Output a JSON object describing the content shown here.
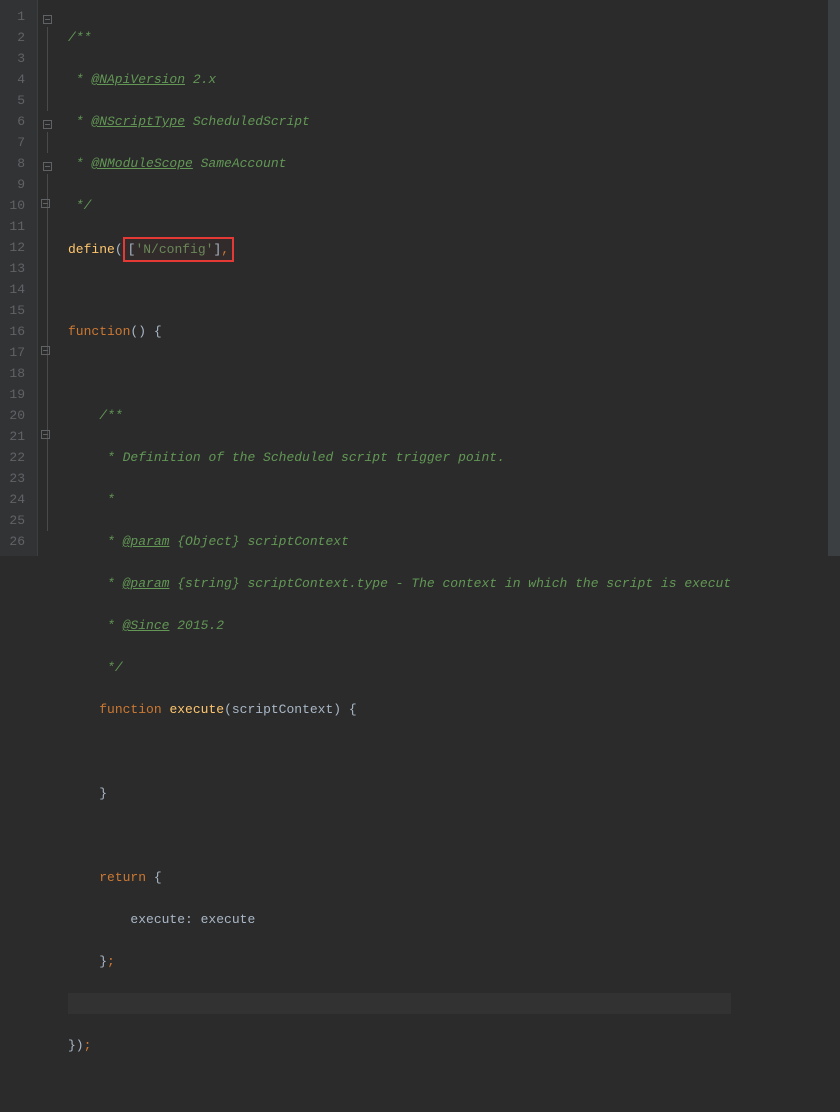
{
  "editor": {
    "line_count": 26,
    "highlight_text": "['N/config'],",
    "lines": {
      "l1": {
        "doc_open": "/**"
      },
      "l2": {
        "star": " * ",
        "tag": "@NApiVersion",
        "rest": " 2.x"
      },
      "l3": {
        "star": " * ",
        "tag": "@NScriptType",
        "rest": " ScheduledScript"
      },
      "l4": {
        "star": " * ",
        "tag": "@NModuleScope",
        "rest": " SameAccount"
      },
      "l5": {
        "doc_close": " */"
      },
      "l6": {
        "define": "define",
        "paren_open": "(",
        "paren_close": ""
      },
      "l8": {
        "kw": "function",
        "args": "() {"
      },
      "l10": {
        "doc_open": "/**"
      },
      "l11": {
        "star": " * ",
        "text": "Definition of the Scheduled script trigger point."
      },
      "l12": {
        "star": " *"
      },
      "l13": {
        "star": " * ",
        "tag": "@param",
        "rest": " {Object} scriptContext"
      },
      "l14": {
        "star": " * ",
        "tag": "@param",
        "rest": " {string} scriptContext.type - The context in which the script is execut"
      },
      "l15": {
        "star": " * ",
        "tag": "@Since",
        "rest": " 2015.2"
      },
      "l16": {
        "doc_close": " */"
      },
      "l17": {
        "kw": "function",
        "fn": " execute",
        "args": "(scriptContext) {"
      },
      "l19": {
        "brace": "}"
      },
      "l21": {
        "kw": "return",
        "brace": " {"
      },
      "l22": {
        "prop": "execute: execute"
      },
      "l23": {
        "brace": "};"
      },
      "l25": {
        "brace": "});"
      }
    }
  }
}
